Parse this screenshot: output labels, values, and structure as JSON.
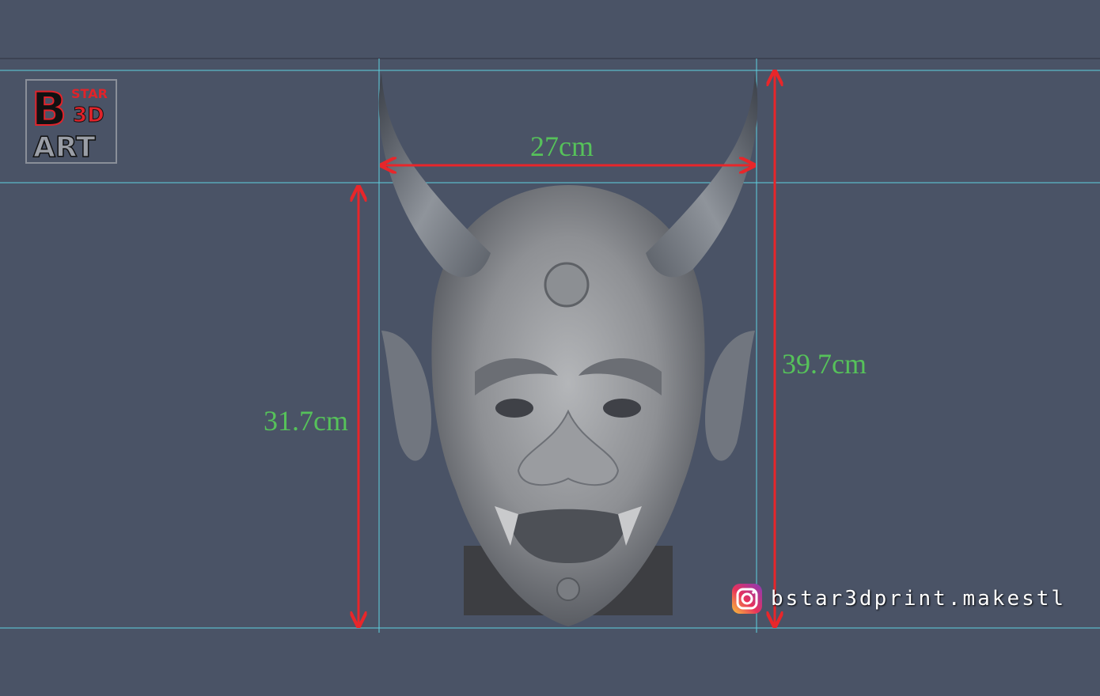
{
  "brand": {
    "logo_b": "B",
    "logo_star": "STAR",
    "logo_3d": "3D",
    "logo_art": "ART"
  },
  "dimensions": {
    "width_label": "27cm",
    "total_height_label": "39.7cm",
    "face_height_label": "31.7cm"
  },
  "social": {
    "icon": "instagram-icon",
    "handle": "bstar3dprint.makestl"
  },
  "colors": {
    "background": "#4a5366",
    "guide_line": "#5fd0e0",
    "arrow": "#e8262a",
    "label": "#56c25a"
  }
}
